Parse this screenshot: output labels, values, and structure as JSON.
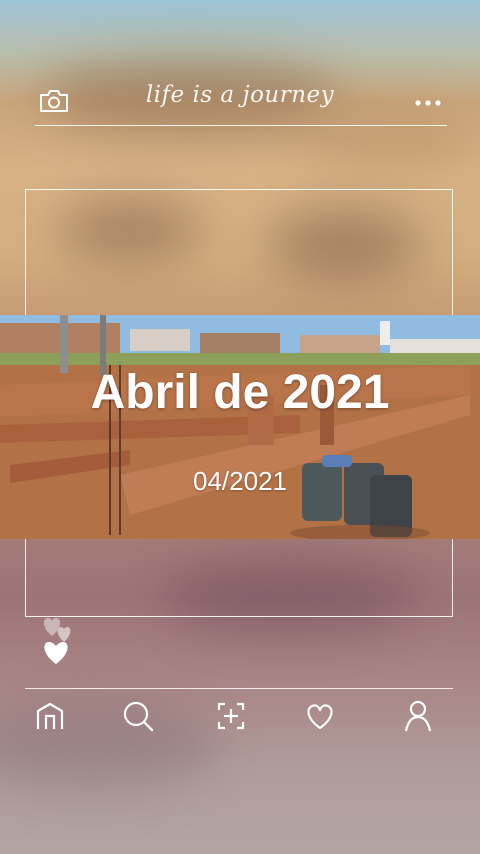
{
  "header": {
    "title": "life is a journey",
    "camera_icon": "camera-icon",
    "more_icon": "more-dots-icon"
  },
  "post": {
    "title": "Abril de 2021",
    "date": "04/2021"
  },
  "reactions": {
    "icon": "hearts-icon"
  },
  "nav": {
    "items": [
      {
        "name": "home",
        "icon": "home-icon"
      },
      {
        "name": "search",
        "icon": "search-icon"
      },
      {
        "name": "add",
        "icon": "add-photo-icon"
      },
      {
        "name": "likes",
        "icon": "heart-icon"
      },
      {
        "name": "profile",
        "icon": "profile-icon"
      }
    ]
  },
  "colors": {
    "line": "#ffffff",
    "sky": "#8fb8d8",
    "soil": "#b3754a"
  }
}
